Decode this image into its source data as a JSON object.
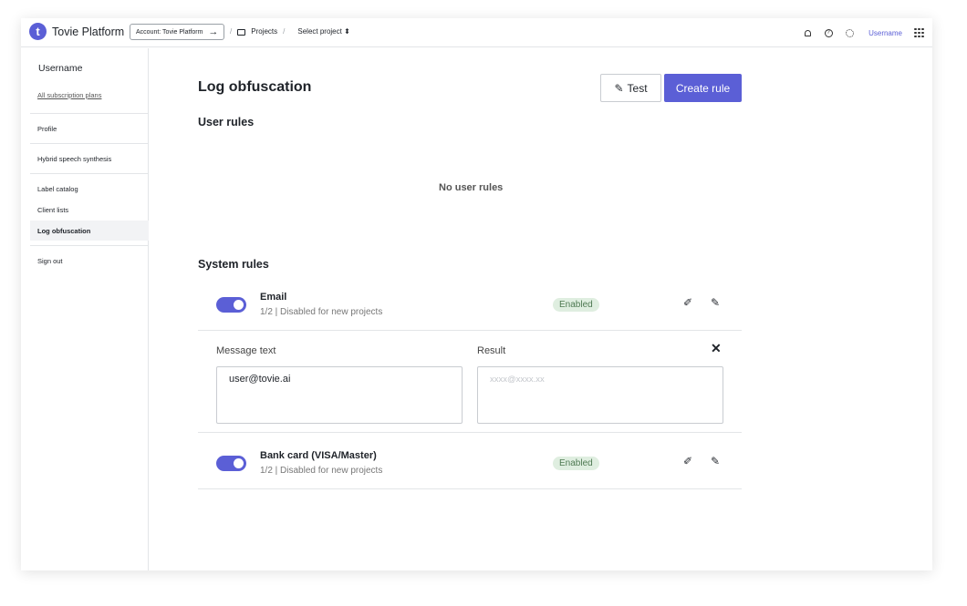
{
  "header": {
    "logo_letter": "t",
    "brand": "Tovie Platform",
    "account_label": "Account: Tovie Platform",
    "account_arrow": "→",
    "crumb_sep1": "/",
    "projects": "Projects",
    "crumb_sep2": "/",
    "select_project": "Select project ⬍",
    "username": "Username"
  },
  "sidebar": {
    "username": "Username",
    "plans_link": "All subscription plans",
    "items": [
      {
        "label": "Profile"
      },
      {
        "label": "Hybrid speech synthesis"
      },
      {
        "label": "Label catalog"
      },
      {
        "label": "Client lists"
      },
      {
        "label": "Log obfuscation"
      },
      {
        "label": "Sign out"
      }
    ]
  },
  "main": {
    "title": "Log obfuscation",
    "test_label": "Test",
    "create_label": "Create rule",
    "user_rules_title": "User rules",
    "no_user_rules": "No user rules",
    "system_rules_title": "System rules",
    "rules": [
      {
        "name": "Email",
        "desc": "1/2 | Disabled for new projects",
        "status": "Enabled",
        "enabled": true
      },
      {
        "name": "Bank card (VISA/Master)",
        "desc": "1/2 | Disabled for new projects",
        "status": "Enabled",
        "enabled": true
      }
    ],
    "test_panel": {
      "message_label": "Message text",
      "message_value": "user@tovie.ai",
      "result_label": "Result",
      "result_placeholder": "xxxx@xxxx.xx",
      "close": "✕"
    }
  },
  "colors": {
    "accent": "#5b5fd6",
    "badge_bg": "#dfeee0",
    "badge_text": "#4f7a53"
  }
}
